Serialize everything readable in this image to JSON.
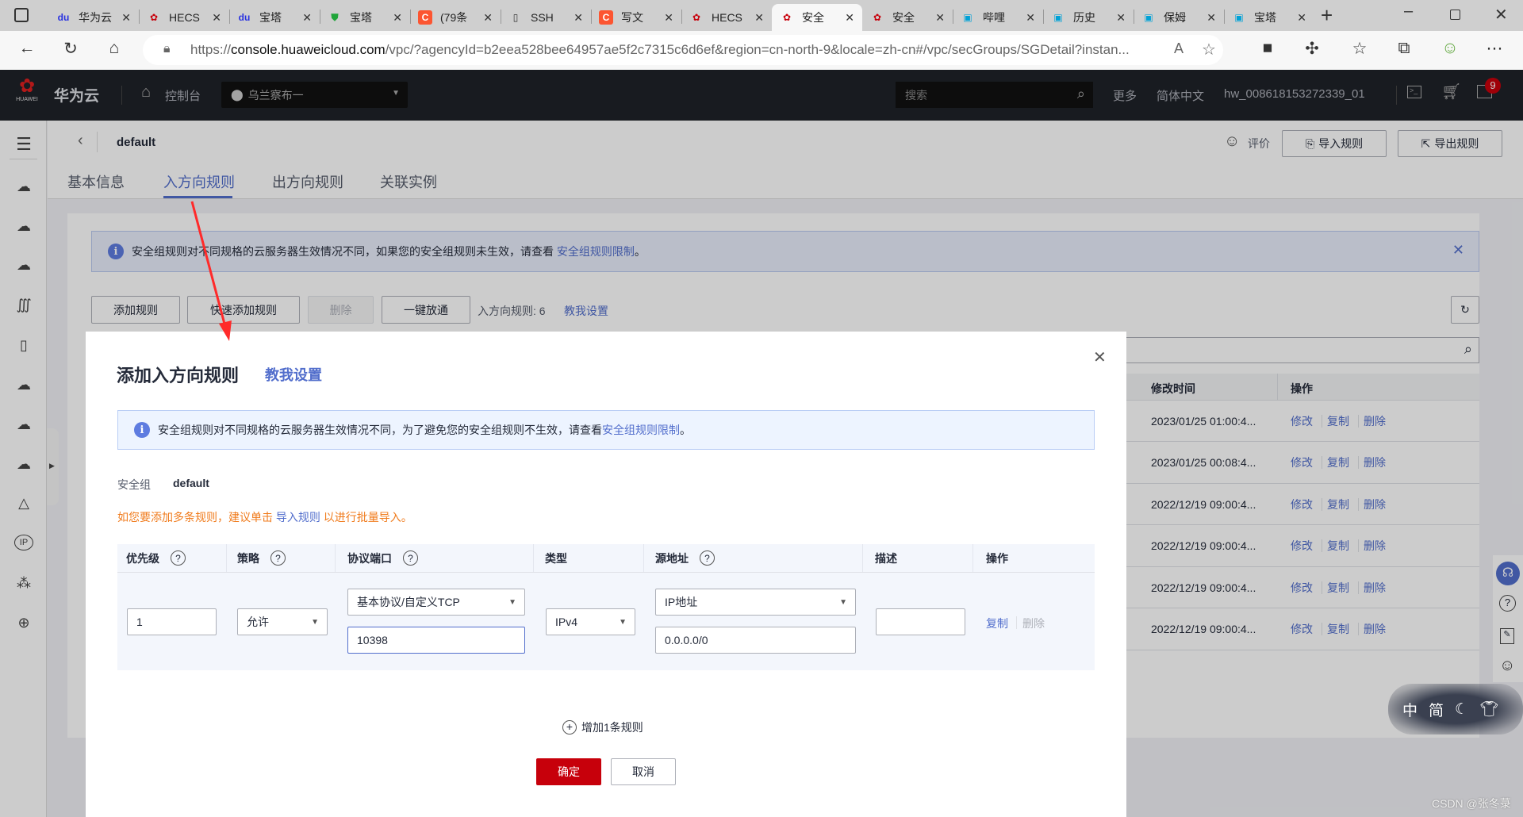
{
  "browser": {
    "tabs": [
      {
        "title": "华为云",
        "icon": "baidu-paw-icon",
        "color": "#2932e1"
      },
      {
        "title": "HECS",
        "icon": "huawei-logo-icon",
        "color": "#c7000b"
      },
      {
        "title": "宝塔",
        "icon": "baidu-paw-icon",
        "color": "#2932e1"
      },
      {
        "title": "宝塔",
        "icon": "bt-shield-icon",
        "color": "#20a53a"
      },
      {
        "title": "(79条",
        "icon": "csdn-c-icon",
        "color": "#fc5531"
      },
      {
        "title": "SSH",
        "icon": "file-icon",
        "color": "#333333"
      },
      {
        "title": "写文",
        "icon": "csdn-c-icon",
        "color": "#fc5531"
      },
      {
        "title": "HECS",
        "icon": "huawei-logo-icon",
        "color": "#c7000b"
      },
      {
        "title": "安全",
        "icon": "huawei-logo-icon",
        "color": "#c7000b",
        "active": true
      },
      {
        "title": "安全",
        "icon": "huawei-logo-icon",
        "color": "#c7000b"
      },
      {
        "title": "哔哩",
        "icon": "bilibili-icon",
        "color": "#00a1d6"
      },
      {
        "title": "历史",
        "icon": "bilibili-icon",
        "color": "#00a1d6"
      },
      {
        "title": "保姆",
        "icon": "bilibili-icon",
        "color": "#00a1d6"
      },
      {
        "title": "宝塔",
        "icon": "bilibili-icon",
        "color": "#00a1d6"
      }
    ],
    "url_prefix": "https://",
    "url_domain": "console.huaweicloud.com",
    "url_rest": "/vpc/?agencyId=b2eea528bee64957ae5f2c7315c6d6ef&region=cn-north-9&locale=zh-cn#/vpc/secGroups/SGDetail?instan..."
  },
  "header": {
    "brand": "华为云",
    "logo_text": "HUAWEI",
    "console": "控制台",
    "region": "乌兰察布一",
    "search_placeholder": "搜索",
    "more": "更多",
    "language": "简体中文",
    "user": "hw_008618153272339_01",
    "notification_count": "9",
    "brand_color": "#c7000b"
  },
  "page": {
    "title": "default",
    "rate": "评价",
    "import": "导入规则",
    "export": "导出规则",
    "tabs": [
      "基本信息",
      "入方向规则",
      "出方向规则",
      "关联实例"
    ],
    "active_tab": 1,
    "notice": "安全组规则对不同规格的云服务器生效情况不同，如果您的安全组规则未生效，请查看",
    "notice_link": "安全组规则限制",
    "notice_end": "。",
    "toolbar": {
      "add": "添加规则",
      "quick_add": "快速添加规则",
      "delete": "删除",
      "allow_all": "一键放通",
      "count_label": "入方向规则: 6",
      "help": "教我设置"
    },
    "table": {
      "headers": {
        "modified": "修改时间",
        "actions": "操作"
      },
      "rows": [
        {
          "modified": "2023/01/25 01:00:4..."
        },
        {
          "modified": "2023/01/25 00:08:4..."
        },
        {
          "modified": "2022/12/19 09:00:4..."
        },
        {
          "modified": "2022/12/19 09:00:4..."
        },
        {
          "modified": "2022/12/19 09:00:4..."
        },
        {
          "modified": "2022/12/19 09:00:4..."
        }
      ],
      "action_labels": {
        "edit": "修改",
        "copy": "复制",
        "delete": "删除"
      }
    }
  },
  "modal": {
    "title": "添加入方向规则",
    "help": "教我设置",
    "info": "安全组规则对不同规格的云服务器生效情况不同，为了避免您的安全组规则不生效，请查看",
    "info_link": "安全组规则限制",
    "info_end": "。",
    "sg_label": "安全组",
    "sg_value": "default",
    "hint_pre": "如您要添加多条规则，建议单击",
    "hint_link": "导入规则",
    "hint_post": "以进行批量导入。",
    "columns": [
      "优先级",
      "策略",
      "协议端口",
      "类型",
      "源地址",
      "描述",
      "操作"
    ],
    "row": {
      "priority": "1",
      "policy": "允许",
      "protocol": "基本协议/自定义TCP",
      "port": "10398",
      "type": "IPv4",
      "source_type": "IP地址",
      "source": "0.0.0.0/0",
      "description": "",
      "copy": "复制",
      "delete": "删除"
    },
    "add_row": "增加1条规则",
    "confirm": "确定",
    "cancel": "取消"
  },
  "ime_widget": {
    "lang": "中",
    "mode": "简"
  },
  "watermark": "CSDN @张冬菉"
}
